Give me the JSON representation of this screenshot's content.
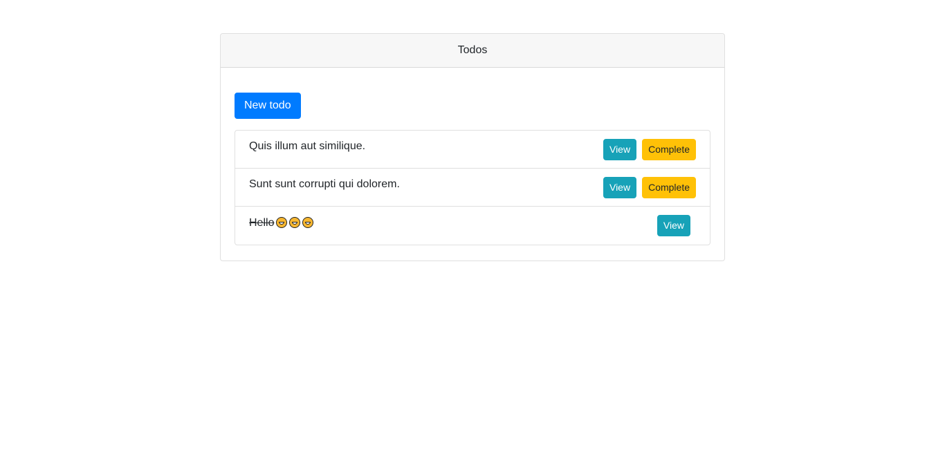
{
  "card": {
    "title": "Todos"
  },
  "new_todo_label": "New todo",
  "todos": [
    {
      "text": "Quis illum aut similique.",
      "completed": false,
      "view_label": "View",
      "complete_label": "Complete"
    },
    {
      "text": "Sunt sunt corrupti qui dolorem.",
      "completed": false,
      "view_label": "View",
      "complete_label": "Complete"
    },
    {
      "text": "Hello",
      "emoji_count": 3,
      "emoji_icon": "laughing-face-icon",
      "completed": true,
      "view_label": "View"
    }
  ],
  "colors": {
    "primary": "#007bff",
    "info": "#17a2b8",
    "warning": "#ffc107"
  }
}
